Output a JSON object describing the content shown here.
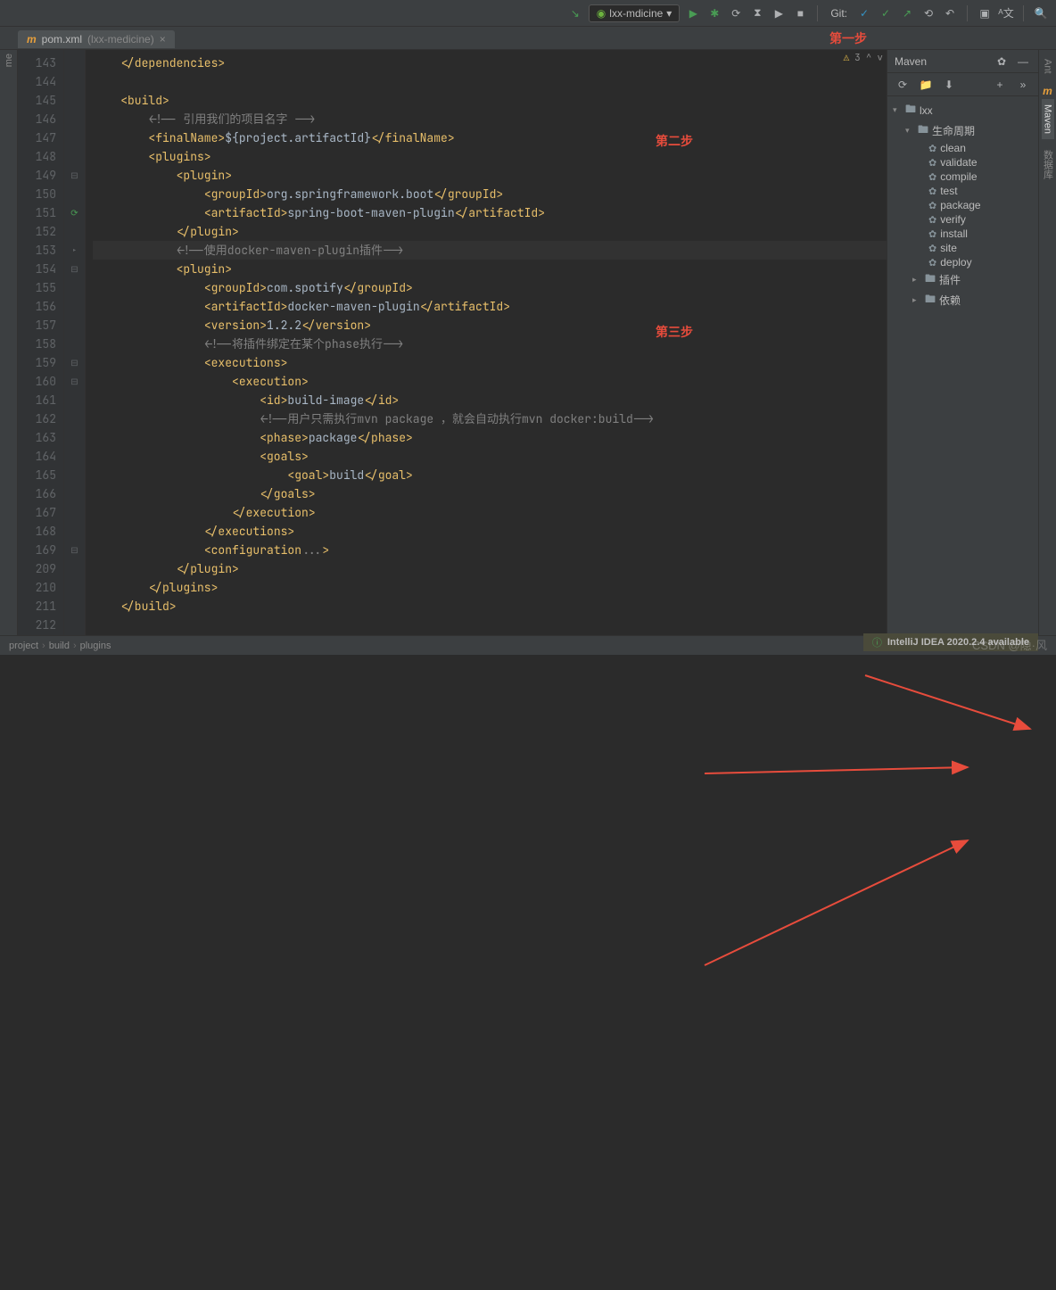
{
  "toolbar": {
    "run_config": "lxx-mdicine",
    "git_label": "Git:"
  },
  "tab": {
    "filename": "pom.xml",
    "context": "(lxx-medicine)"
  },
  "editor": {
    "warnings": "3",
    "lines": [
      {
        "n": "143",
        "html": "<span class='t-tag'>&lt;/dependencies&gt;</span>"
      },
      {
        "n": "144",
        "html": ""
      },
      {
        "n": "145",
        "html": "<span class='t-tag'>&lt;build&gt;</span>"
      },
      {
        "n": "146",
        "html": "    <span class='t-com'>&lt;!-- 引用我们的项目名字 --&gt;</span>"
      },
      {
        "n": "147",
        "html": "    <span class='t-tag'>&lt;finalName&gt;</span><span class='t-txt'>${project.artifactId}</span><span class='t-tag'>&lt;/finalName&gt;</span>"
      },
      {
        "n": "148",
        "html": "    <span class='t-tag'>&lt;plugins&gt;</span>"
      },
      {
        "n": "149",
        "html": "        <span class='t-tag'>&lt;plugin&gt;</span>"
      },
      {
        "n": "150",
        "html": "            <span class='t-tag'>&lt;groupId&gt;</span><span class='t-txt'>org.springframework.boot</span><span class='t-tag'>&lt;/groupId&gt;</span>"
      },
      {
        "n": "151",
        "html": "            <span class='t-tag'>&lt;artifactId&gt;</span><span class='t-txt'>spring-boot-maven-plugin</span><span class='t-tag'>&lt;/artifactId&gt;</span>"
      },
      {
        "n": "152",
        "html": "        <span class='t-tag'>&lt;/plugin&gt;</span>"
      },
      {
        "n": "153",
        "html": "        <span class='t-com'>&lt;!--使用docker-maven-plugin插件--&gt;</span>",
        "hl": true
      },
      {
        "n": "154",
        "html": "        <span class='t-tag'>&lt;plugin&gt;</span>"
      },
      {
        "n": "155",
        "html": "            <span class='t-tag'>&lt;groupId&gt;</span><span class='t-txt'>com.spotify</span><span class='t-tag'>&lt;/groupId&gt;</span>"
      },
      {
        "n": "156",
        "html": "            <span class='t-tag'>&lt;artifactId&gt;</span><span class='t-txt'>docker-maven-plugin</span><span class='t-tag'>&lt;/artifactId&gt;</span>"
      },
      {
        "n": "157",
        "html": "            <span class='t-tag'>&lt;version&gt;</span><span class='t-txt'>1.2.2</span><span class='t-tag'>&lt;/version&gt;</span>"
      },
      {
        "n": "158",
        "html": "            <span class='t-com'>&lt;!--将插件绑定在某个phase执行--&gt;</span>"
      },
      {
        "n": "159",
        "html": "            <span class='t-tag'>&lt;executions&gt;</span>"
      },
      {
        "n": "160",
        "html": "                <span class='t-tag'>&lt;execution&gt;</span>"
      },
      {
        "n": "161",
        "html": "                    <span class='t-tag'>&lt;id&gt;</span><span class='t-txt'>build-image</span><span class='t-tag'>&lt;/id&gt;</span>"
      },
      {
        "n": "162",
        "html": "                    <span class='t-com'>&lt;!--用户只需执行mvn package ，就会自动执行mvn docker:build--&gt;</span>"
      },
      {
        "n": "163",
        "html": "                    <span class='t-tag'>&lt;phase&gt;</span><span class='t-txt'>package</span><span class='t-tag'>&lt;/phase&gt;</span>"
      },
      {
        "n": "164",
        "html": "                    <span class='t-tag'>&lt;goals&gt;</span>"
      },
      {
        "n": "165",
        "html": "                        <span class='t-tag'>&lt;goal&gt;</span><span class='t-txt'>build</span><span class='t-tag'>&lt;/goal&gt;</span>"
      },
      {
        "n": "166",
        "html": "                    <span class='t-tag'>&lt;/goals&gt;</span>"
      },
      {
        "n": "167",
        "html": "                <span class='t-tag'>&lt;/execution&gt;</span>"
      },
      {
        "n": "168",
        "html": "            <span class='t-tag'>&lt;/executions&gt;</span>"
      },
      {
        "n": "169",
        "html": "            <span class='t-tag'>&lt;configuration</span><span class='t-com'>...</span><span class='t-tag'>&gt;</span>"
      },
      {
        "n": "209",
        "html": "        <span class='t-tag'>&lt;/plugin&gt;</span>"
      },
      {
        "n": "210",
        "html": "    <span class='t-tag'>&lt;/plugins&gt;</span>"
      },
      {
        "n": "211",
        "html": "<span class='t-tag'>&lt;/build&gt;</span>"
      },
      {
        "n": "212",
        "html": ""
      }
    ]
  },
  "maven": {
    "title": "Maven",
    "root": "lxx",
    "lifecycle_label": "生命周期",
    "phases": [
      "clean",
      "validate",
      "compile",
      "test",
      "package",
      "verify",
      "install",
      "site",
      "deploy"
    ],
    "plugins_label": "插件",
    "deps_label": "依赖"
  },
  "right_tabs": {
    "ant": "Ant",
    "maven": "Maven",
    "db": "数据库"
  },
  "breadcrumb": [
    "project",
    "build",
    "plugins"
  ],
  "notification": "IntelliJ IDEA 2020.2.4 available",
  "annotations": {
    "step1": "第一步",
    "step2": "第二步",
    "step3": "第三步"
  },
  "watermark": "CSDN @隐·风"
}
